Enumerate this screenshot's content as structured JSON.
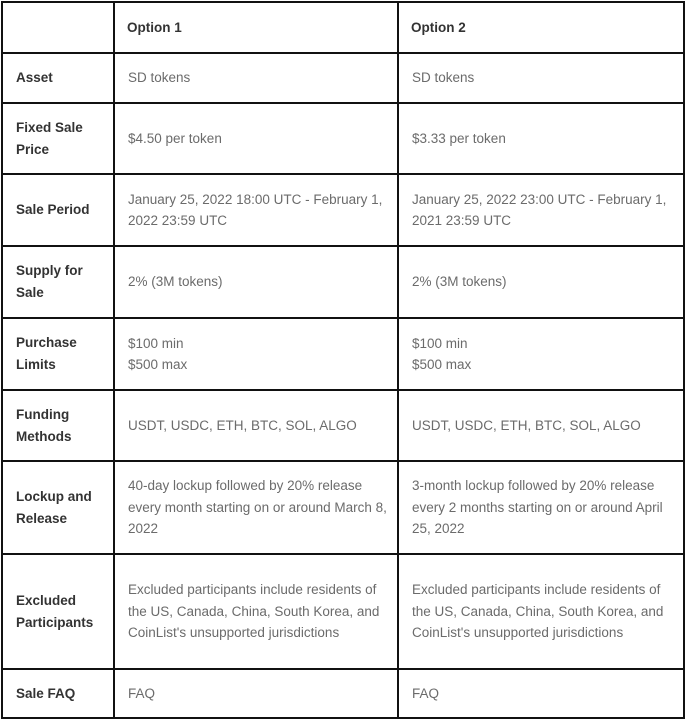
{
  "table": {
    "columns": [
      "",
      "Option 1",
      "Option 2"
    ],
    "rows": [
      {
        "label": "Asset",
        "option1": [
          "SD tokens"
        ],
        "option2": [
          "SD tokens"
        ]
      },
      {
        "label": "Fixed Sale Price",
        "option1": [
          "$4.50 per token"
        ],
        "option2": [
          "$3.33 per token"
        ]
      },
      {
        "label": "Sale Period",
        "option1": [
          "January 25, 2022 18:00 UTC - February 1, 2022 23:59 UTC"
        ],
        "option2": [
          "January 25, 2022 23:00 UTC - February 1, 2021 23:59 UTC"
        ]
      },
      {
        "label": "Supply for Sale",
        "option1": [
          "2% (3M tokens)"
        ],
        "option2": [
          "2% (3M tokens)"
        ]
      },
      {
        "label": "Purchase Limits",
        "option1": [
          "$100 min",
          "$500 max"
        ],
        "option2": [
          "$100 min",
          "$500 max"
        ]
      },
      {
        "label": "Funding Methods",
        "option1": [
          "USDT, USDC, ETH, BTC, SOL, ALGO"
        ],
        "option2": [
          "USDT, USDC, ETH, BTC, SOL, ALGO"
        ]
      },
      {
        "label": "Lockup and Release",
        "option1": [
          "40-day lockup followed by 20% release every month starting on or around March 8, 2022"
        ],
        "option2": [
          "3-month lockup followed by 20% release every 2 months starting on or around April 25, 2022"
        ]
      },
      {
        "label": "Excluded Participants",
        "option1": [
          "Excluded participants include residents of the US, Canada, China, South Korea, and CoinList's unsupported jurisdictions"
        ],
        "option2": [
          "Excluded participants include residents of the US, Canada, China, South Korea, and CoinList's unsupported jurisdictions"
        ]
      },
      {
        "label": "Sale FAQ",
        "option1": [
          "FAQ"
        ],
        "option2": [
          "FAQ"
        ]
      }
    ]
  },
  "colors": {
    "border": "#111111",
    "label_text": "#333333",
    "body_text": "#6b6b6b",
    "background": "#ffffff"
  }
}
